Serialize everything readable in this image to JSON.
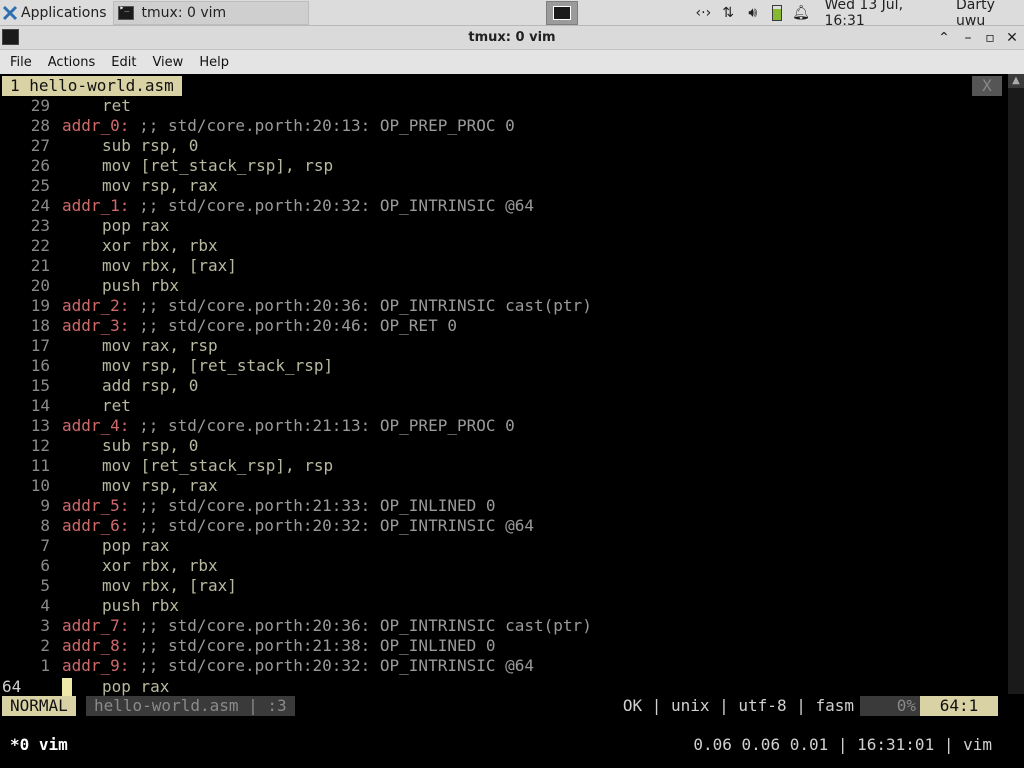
{
  "panel": {
    "applications_label": "Applications",
    "task_title": "tmux: 0 vim",
    "clock": "Wed 13 Jul, 16:31",
    "user": "Darty uwu",
    "tray_icons": [
      "network-icon",
      "transfer-icon",
      "volume-icon",
      "battery-icon",
      "notification-bell-icon"
    ]
  },
  "window": {
    "title": "tmux: 0 vim",
    "controls": [
      "maximize",
      "minimize",
      "restore",
      "close"
    ]
  },
  "menu": [
    "File",
    "Actions",
    "Edit",
    "View",
    "Help"
  ],
  "vim": {
    "tab_label": "1 hello-world.asm",
    "tab_close": "X",
    "lines": [
      {
        "n": "29",
        "label": "",
        "comment": "",
        "code": "ret"
      },
      {
        "n": "28",
        "label": "addr_0:",
        "comment": ";; std/core.porth:20:13: OP_PREP_PROC 0",
        "code": ""
      },
      {
        "n": "27",
        "label": "",
        "comment": "",
        "code": "sub rsp, 0"
      },
      {
        "n": "26",
        "label": "",
        "comment": "",
        "code": "mov [ret_stack_rsp], rsp"
      },
      {
        "n": "25",
        "label": "",
        "comment": "",
        "code": "mov rsp, rax"
      },
      {
        "n": "24",
        "label": "addr_1:",
        "comment": ";; std/core.porth:20:32: OP_INTRINSIC @64",
        "code": ""
      },
      {
        "n": "23",
        "label": "",
        "comment": "",
        "code": "pop rax"
      },
      {
        "n": "22",
        "label": "",
        "comment": "",
        "code": "xor rbx, rbx"
      },
      {
        "n": "21",
        "label": "",
        "comment": "",
        "code": "mov rbx, [rax]"
      },
      {
        "n": "20",
        "label": "",
        "comment": "",
        "code": "push rbx"
      },
      {
        "n": "19",
        "label": "addr_2:",
        "comment": ";; std/core.porth:20:36: OP_INTRINSIC cast(ptr)",
        "code": ""
      },
      {
        "n": "18",
        "label": "addr_3:",
        "comment": ";; std/core.porth:20:46: OP_RET 0",
        "code": ""
      },
      {
        "n": "17",
        "label": "",
        "comment": "",
        "code": "mov rax, rsp"
      },
      {
        "n": "16",
        "label": "",
        "comment": "",
        "code": "mov rsp, [ret_stack_rsp]"
      },
      {
        "n": "15",
        "label": "",
        "comment": "",
        "code": "add rsp, 0"
      },
      {
        "n": "14",
        "label": "",
        "comment": "",
        "code": "ret"
      },
      {
        "n": "13",
        "label": "addr_4:",
        "comment": ";; std/core.porth:21:13: OP_PREP_PROC 0",
        "code": ""
      },
      {
        "n": "12",
        "label": "",
        "comment": "",
        "code": "sub rsp, 0"
      },
      {
        "n": "11",
        "label": "",
        "comment": "",
        "code": "mov [ret_stack_rsp], rsp"
      },
      {
        "n": "10",
        "label": "",
        "comment": "",
        "code": "mov rsp, rax"
      },
      {
        "n": "9",
        "label": "addr_5:",
        "comment": ";; std/core.porth:21:33: OP_INLINED 0",
        "code": ""
      },
      {
        "n": "8",
        "label": "addr_6:",
        "comment": ";; std/core.porth:20:32: OP_INTRINSIC @64",
        "code": ""
      },
      {
        "n": "7",
        "label": "",
        "comment": "",
        "code": "pop rax"
      },
      {
        "n": "6",
        "label": "",
        "comment": "",
        "code": "xor rbx, rbx"
      },
      {
        "n": "5",
        "label": "",
        "comment": "",
        "code": "mov rbx, [rax]"
      },
      {
        "n": "4",
        "label": "",
        "comment": "",
        "code": "push rbx"
      },
      {
        "n": "3",
        "label": "addr_7:",
        "comment": ";; std/core.porth:20:36: OP_INTRINSIC cast(ptr)",
        "code": ""
      },
      {
        "n": "2",
        "label": "addr_8:",
        "comment": ";; std/core.porth:21:38: OP_INLINED 0",
        "code": ""
      },
      {
        "n": "1",
        "label": "addr_9:",
        "comment": ";; std/core.porth:20:32: OP_INTRINSIC @64",
        "code": ""
      }
    ],
    "current_line_number": "64",
    "current_line_code": "pop rax",
    "status": {
      "mode": "NORMAL",
      "file": "hello-world.asm | :3",
      "info": "OK | unix | utf-8 | fasm",
      "percent": "0%",
      "position": "64:1"
    }
  },
  "tmux": {
    "window": "*0 vim",
    "status_right": "0.06 0.06 0.01 | 16:31:01 | vim"
  }
}
